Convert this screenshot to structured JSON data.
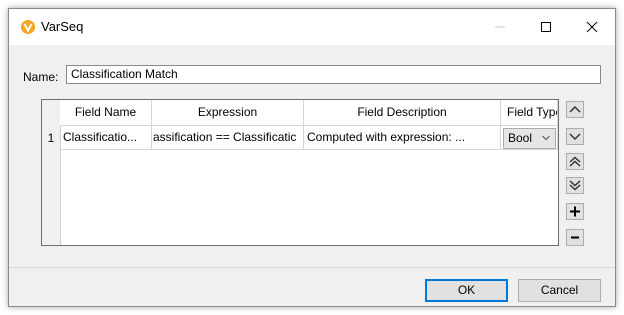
{
  "window": {
    "title": "VarSeq",
    "accent_color": "#f5a623"
  },
  "name_field": {
    "label": "Name:",
    "value": "Classification Match"
  },
  "table": {
    "columns": [
      "Field Name",
      "Expression",
      "Field Description",
      "Field Type"
    ],
    "rows": [
      {
        "number": "1",
        "field_name": "Classificatio...",
        "expression": "assification == Classificatic",
        "description": "Computed with expression: ...",
        "field_type": "Bool"
      }
    ]
  },
  "side_buttons": [
    "move-up-icon",
    "move-down-icon",
    "move-top-icon",
    "move-bottom-icon",
    "add-icon",
    "remove-icon"
  ],
  "buttons": {
    "ok": "OK",
    "cancel": "Cancel"
  }
}
